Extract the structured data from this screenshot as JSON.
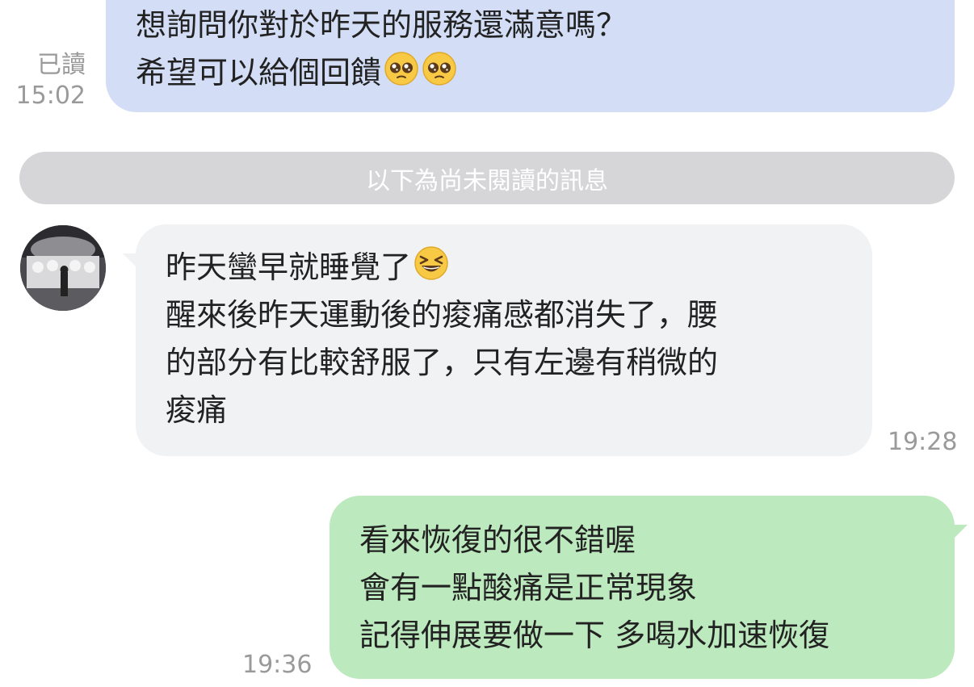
{
  "chat": {
    "top_message": {
      "lines": [
        "想詢問你對於昨天的服務還滿意嗎？",
        "希望可以給個回饋"
      ],
      "emojis": [
        "pleading-face",
        "pleading-face"
      ],
      "read_status": "已讀",
      "time": "15:02",
      "bubble_color": "#d3def6"
    },
    "unread_divider": "以下為尚未閱讀的訊息",
    "incoming_message": {
      "lines": [
        "昨天蠻早就睡覺了",
        "醒來後昨天運動後的痠痛感都消失了，腰",
        "的部分有比較舒服了，只有左邊有稍微的",
        "痠痛"
      ],
      "emojis": [
        "grinning-squinting-face"
      ],
      "time": "19:28",
      "bubble_color": "#f1f2f4",
      "avatar": "contact-avatar-photo"
    },
    "outgoing_message": {
      "lines": [
        "看來恢復的很不錯喔",
        "會有一點酸痛是正常現象",
        "記得伸展要做一下 多喝水加速恢復"
      ],
      "time": "19:36",
      "bubble_color": "#bde9be"
    }
  }
}
